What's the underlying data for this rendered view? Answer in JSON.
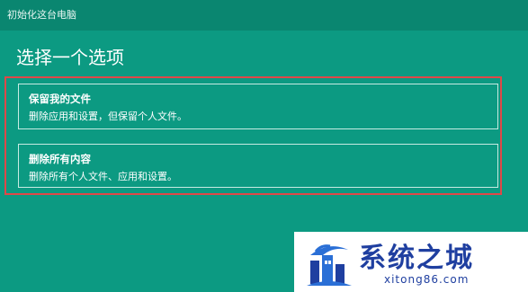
{
  "window": {
    "title": "初始化这台电脑"
  },
  "page": {
    "heading": "选择一个选项"
  },
  "options": [
    {
      "title": "保留我的文件",
      "description": "删除应用和设置，但保留个人文件。"
    },
    {
      "title": "删除所有内容",
      "description": "删除所有个人文件、应用和设置。"
    }
  ],
  "watermark": {
    "name": "系统之城",
    "url": "xitong86.com",
    "logo_icon": "castle-logo-icon"
  },
  "colors": {
    "background": "#0c9a82",
    "titlebar": "#0a8670",
    "highlight_box": "#e04848",
    "option_border": "#c7ebe3",
    "watermark_text": "#1f3fa0"
  }
}
